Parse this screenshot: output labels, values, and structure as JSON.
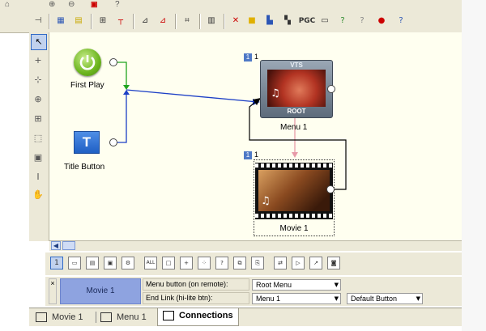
{
  "canvas": {
    "nodes": {
      "first_play": {
        "label": "First Play"
      },
      "title_button": {
        "label": "Title Button",
        "icon_text": "T"
      },
      "menu1": {
        "label": "Menu 1",
        "badge": "1",
        "badge_text": "1",
        "header": "VTS",
        "footer": "ROOT"
      },
      "movie1": {
        "label": "Movie 1",
        "badge": "1",
        "badge_text": "1"
      }
    },
    "colors": {
      "link_blue": "#1c3fc6",
      "link_green": "#1fa31f",
      "link_pink": "#e79aa8",
      "link_black": "#000000"
    }
  },
  "toolbar": {
    "items": [
      "PGC"
    ]
  },
  "bottom_toolbar": {
    "first": "1",
    "all": "ALL"
  },
  "properties": {
    "item_name": "Movie 1",
    "row1_label": "Menu button (on remote):",
    "row1_value": "Root Menu",
    "row2_label": "End Link (hi-lite btn):",
    "row2_value": "Menu 1",
    "row2_extra": "Default Button",
    "close": "×"
  },
  "tabs": [
    {
      "label": "Movie 1"
    },
    {
      "label": "Menu 1"
    },
    {
      "label": "Connections"
    }
  ]
}
